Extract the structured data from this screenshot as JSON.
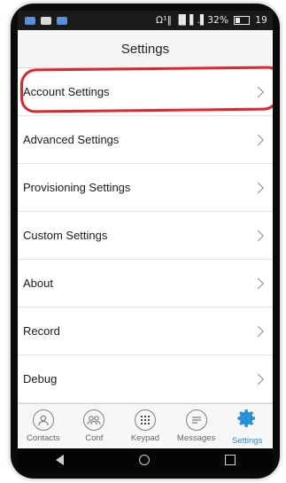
{
  "status_bar": {
    "right_text": "Ω¹‖ ▐▌▌.▌32%",
    "battery_label": "19"
  },
  "header": {
    "title": "Settings"
  },
  "settings_items": [
    {
      "label": "Account Settings"
    },
    {
      "label": "Advanced Settings"
    },
    {
      "label": "Provisioning Settings"
    },
    {
      "label": "Custom Settings"
    },
    {
      "label": "About"
    },
    {
      "label": "Record"
    },
    {
      "label": "Debug"
    }
  ],
  "tabs": [
    {
      "label": "Contacts",
      "icon": "contacts-icon"
    },
    {
      "label": "Conf",
      "icon": "conference-icon"
    },
    {
      "label": "Keypad",
      "icon": "keypad-icon"
    },
    {
      "label": "Messages",
      "icon": "messages-icon"
    },
    {
      "label": "Settings",
      "icon": "gear-icon"
    }
  ],
  "colors": {
    "highlight": "#e3242b",
    "active_tab": "#2a8fd9"
  }
}
